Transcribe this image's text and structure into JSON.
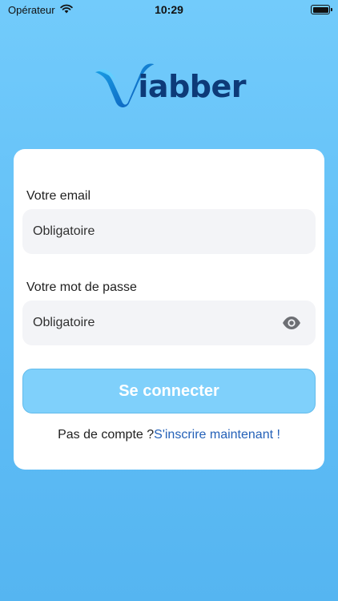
{
  "status_bar": {
    "carrier": "Opérateur",
    "time": "10:29",
    "icons": [
      "wifi-icon",
      "battery-icon"
    ]
  },
  "brand": {
    "logo_text": "iabber",
    "colors": {
      "text": "#0d3a78",
      "accent": "#1f9fe0"
    }
  },
  "form": {
    "email_label": "Votre email",
    "email_placeholder": "Obligatoire",
    "password_label": "Votre mot de passe",
    "password_placeholder": "Obligatoire",
    "password_toggle_icon": "eye-icon",
    "submit_label": "Se connecter",
    "signup_prompt": "Pas de compte ?",
    "signup_link": "S'inscrire maintenant !"
  },
  "colors": {
    "background": "#63c0f7",
    "button": "#7fd0fb",
    "link": "#2461b8"
  }
}
